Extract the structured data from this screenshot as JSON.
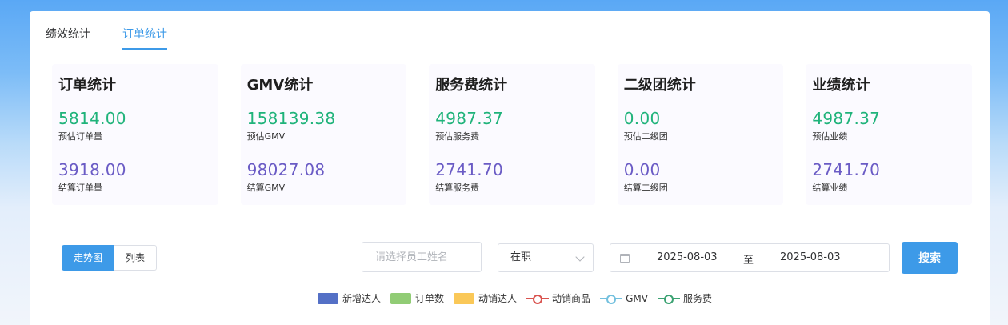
{
  "tabs": [
    {
      "label": "绩效统计",
      "active": false
    },
    {
      "label": "订单统计",
      "active": true
    }
  ],
  "cards": [
    {
      "title": "订单统计",
      "v1": "5814.00",
      "l1": "预估订单量",
      "v2": "3918.00",
      "l2": "结算订单量"
    },
    {
      "title": "GMV统计",
      "v1": "158139.38",
      "l1": "预估GMV",
      "v2": "98027.08",
      "l2": "结算GMV"
    },
    {
      "title": "服务费统计",
      "v1": "4987.37",
      "l1": "预估服务费",
      "v2": "2741.70",
      "l2": "结算服务费"
    },
    {
      "title": "二级团统计",
      "v1": "0.00",
      "l1": "预估二级团",
      "v2": "0.00",
      "l2": "结算二级团"
    },
    {
      "title": "业绩统计",
      "v1": "4987.37",
      "l1": "预估业绩",
      "v2": "2741.70",
      "l2": "结算业绩"
    }
  ],
  "view_toggle": {
    "trend": "走势图",
    "list": "列表",
    "selected": "走势图"
  },
  "filters": {
    "employee_placeholder": "请选择员工姓名",
    "status": "在职",
    "date_start": "2025-08-03",
    "date_sep": "至",
    "date_end": "2025-08-03",
    "search_label": "搜索"
  },
  "legend": [
    {
      "label": "新增达人",
      "type": "bar",
      "color": "#5470c6"
    },
    {
      "label": "订单数",
      "type": "bar",
      "color": "#91cc75"
    },
    {
      "label": "动销达人",
      "type": "bar",
      "color": "#fac858"
    },
    {
      "label": "动销商品",
      "type": "line",
      "color": "#d9534f"
    },
    {
      "label": "GMV",
      "type": "line",
      "color": "#73c0de"
    },
    {
      "label": "服务费",
      "type": "line",
      "color": "#3ba272"
    }
  ]
}
